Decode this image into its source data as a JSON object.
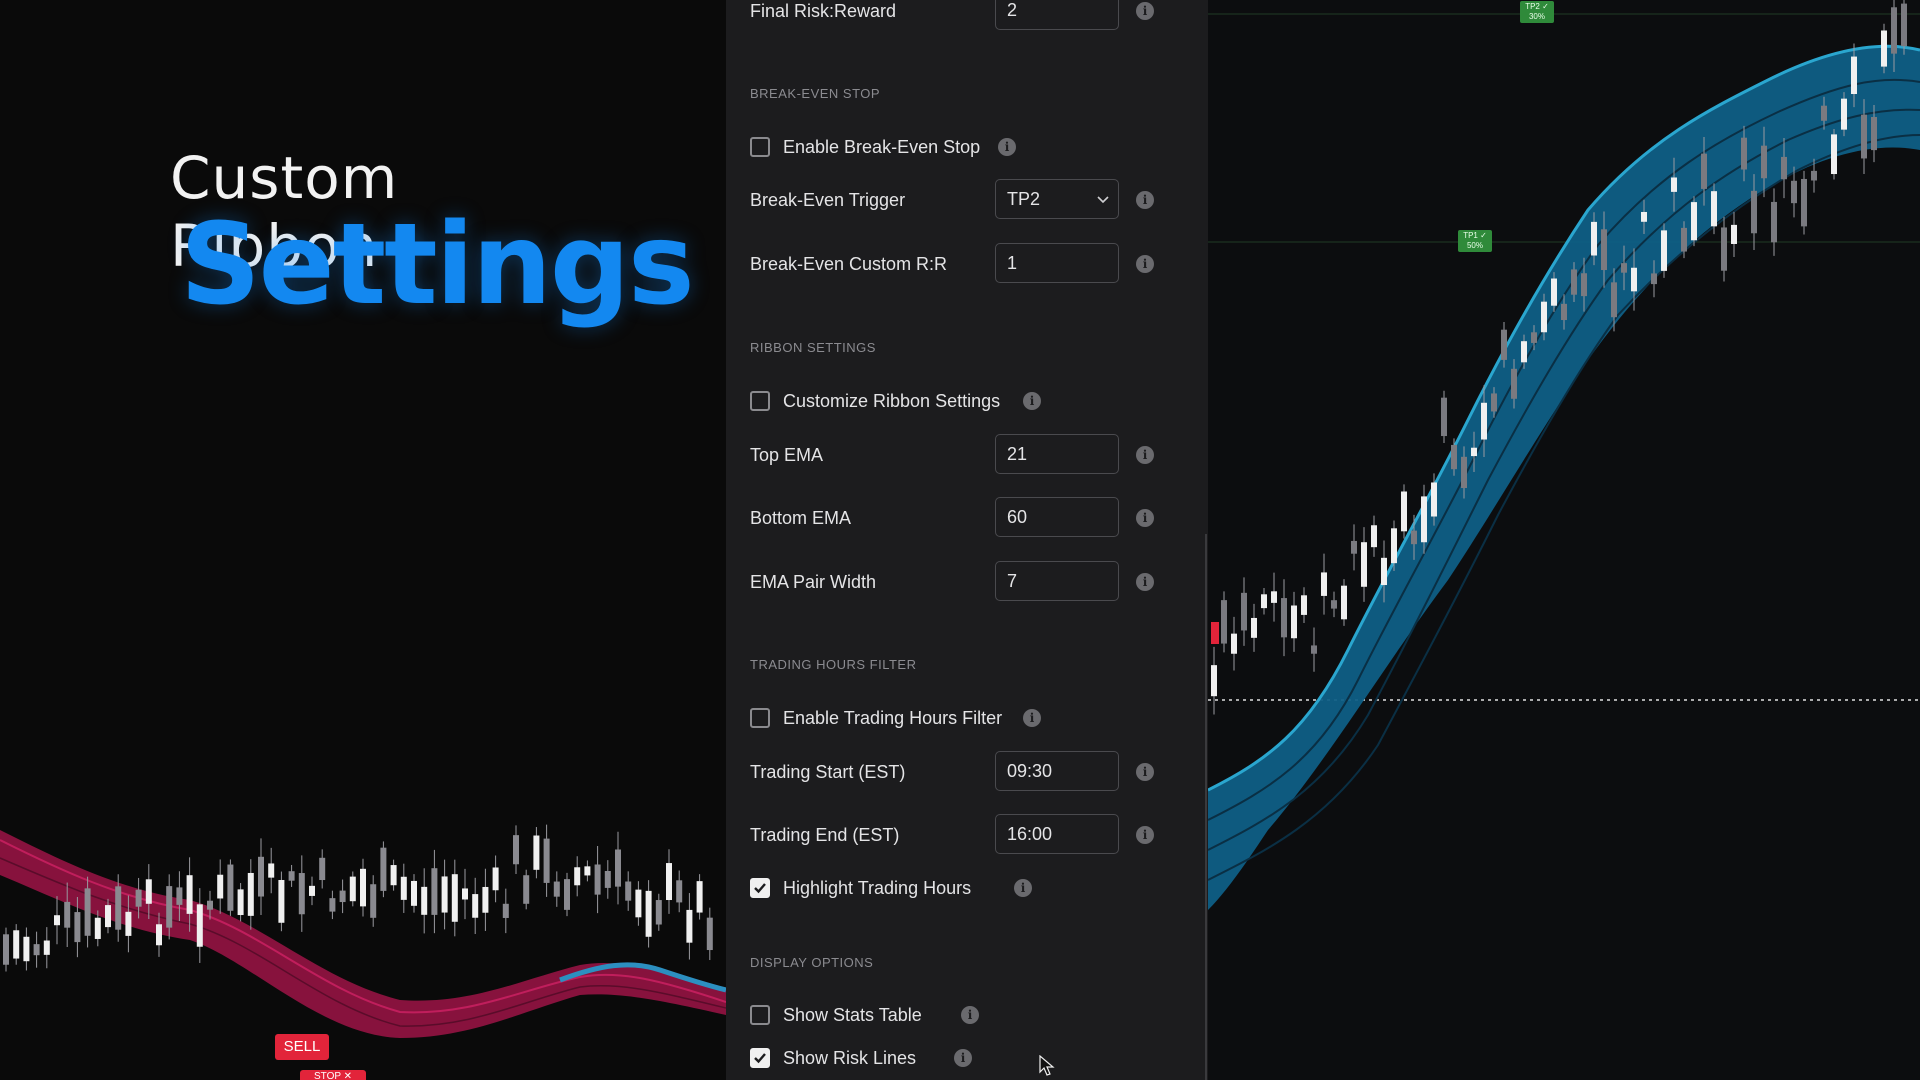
{
  "promo": {
    "title_line1": "Custom Ribbon",
    "title_line2": "Settings",
    "accent_color": "#1388f0"
  },
  "left_chart": {
    "sell_label": "SELL",
    "stop_label": "STOP ✕"
  },
  "settings": {
    "final_rr": {
      "label": "Final Risk:Reward",
      "value": "2"
    },
    "break_even": {
      "section_title": "BREAK-EVEN STOP",
      "enable_label": "Enable Break-Even Stop",
      "enable_checked": false,
      "trigger_label": "Break-Even Trigger",
      "trigger_value": "TP2",
      "custom_rr_label": "Break-Even Custom R:R",
      "custom_rr_value": "1"
    },
    "ribbon": {
      "section_title": "RIBBON SETTINGS",
      "customize_label": "Customize Ribbon Settings",
      "customize_checked": false,
      "top_ema_label": "Top EMA",
      "top_ema_value": "21",
      "bottom_ema_label": "Bottom EMA",
      "bottom_ema_value": "60",
      "pair_width_label": "EMA Pair Width",
      "pair_width_value": "7"
    },
    "trading_hours": {
      "section_title": "TRADING HOURS FILTER",
      "enable_label": "Enable Trading Hours Filter",
      "enable_checked": false,
      "start_label": "Trading Start (EST)",
      "start_value": "09:30",
      "end_label": "Trading End (EST)",
      "end_value": "16:00",
      "highlight_label": "Highlight Trading Hours",
      "highlight_checked": true
    },
    "display": {
      "section_title": "DISPLAY OPTIONS",
      "stats_label": "Show Stats Table",
      "stats_checked": false,
      "risk_lines_label": "Show Risk Lines",
      "risk_lines_checked": true
    }
  },
  "right_chart": {
    "tp2_label": "TP2 ✓",
    "tp2_pct": "30%",
    "tp1_label": "TP1 ✓",
    "tp1_pct": "50%"
  }
}
